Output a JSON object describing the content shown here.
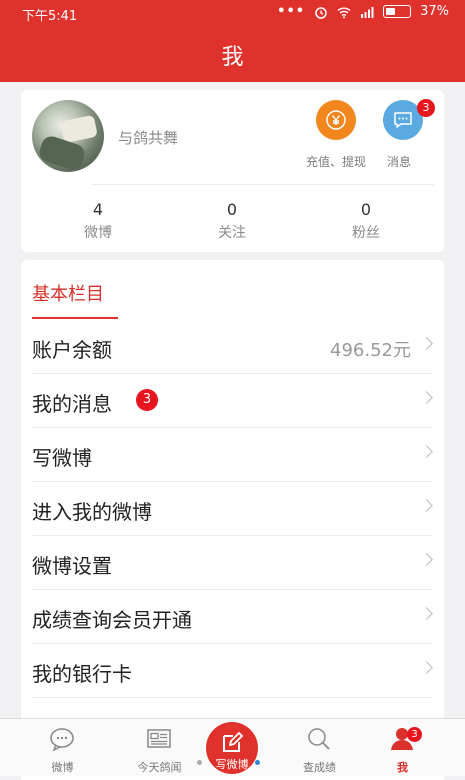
{
  "status_bar": {
    "time": "下午5:41",
    "dots": "•••",
    "network": "4G",
    "battery": "37%"
  },
  "header": {
    "title": "我"
  },
  "profile": {
    "username": "与鸽共舞",
    "recharge_label": "充值、提现",
    "messages_label": "消息",
    "messages_badge": "3",
    "stats": [
      {
        "value": "4",
        "label": "微博"
      },
      {
        "value": "0",
        "label": "关注"
      },
      {
        "value": "0",
        "label": "粉丝"
      }
    ]
  },
  "menu": {
    "section_title": "基本栏目",
    "items": [
      {
        "label": "账户余额",
        "value": "496.52元"
      },
      {
        "label": "我的消息",
        "badge": "3"
      },
      {
        "label": "写微博"
      },
      {
        "label": "进入我的微博"
      },
      {
        "label": "微博设置"
      },
      {
        "label": "成绩查询会员开通"
      },
      {
        "label": "我的银行卡"
      }
    ]
  },
  "tabbar": {
    "tabs": [
      {
        "label": "微博"
      },
      {
        "label": "今天鸽闻"
      },
      {
        "label": "写微博"
      },
      {
        "label": "查成绩"
      },
      {
        "label": "我",
        "badge": "3"
      }
    ]
  },
  "colors": {
    "primary": "#e0322d",
    "recharge": "#f2871f",
    "messages": "#5aa9e0",
    "badge": "#e8141e"
  }
}
